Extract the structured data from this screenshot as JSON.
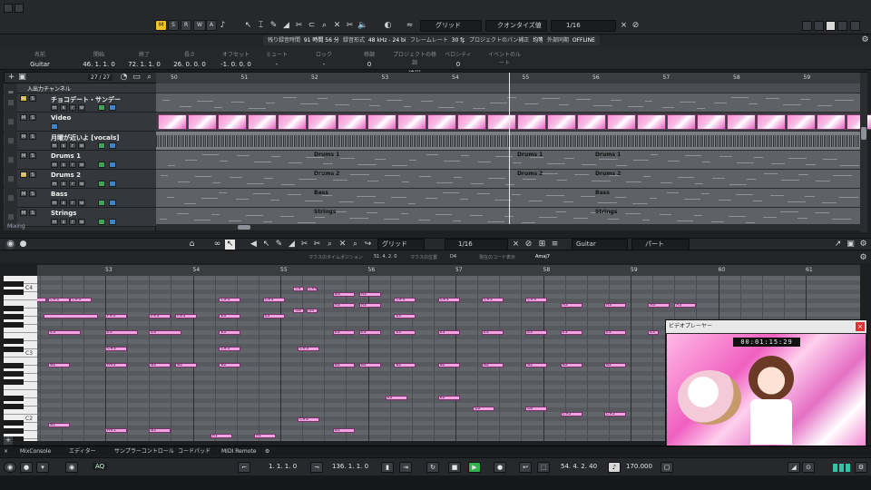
{
  "toolbar": {
    "mode_buttons": [
      "M",
      "S",
      "R",
      "W",
      "A"
    ],
    "grid_label": "グリッド",
    "quantize_label": "クオンタイズ値",
    "quantize_value": "1/16"
  },
  "status_items": [
    {
      "label": "残り録音時間",
      "value": "91 時間 56 分"
    },
    {
      "label": "録音形式",
      "value": "48 kHz - 24 bit"
    },
    {
      "label": "フレームレート",
      "value": "30 fps"
    },
    {
      "label": "プロジェクトのパン補正",
      "value": "均等パワー"
    },
    {
      "label": "外部同期",
      "value": "OFFLINE"
    }
  ],
  "info_line": {
    "name": {
      "header": "名前",
      "value": "Guitar"
    },
    "start": {
      "header": "開始",
      "value": "46. 1. 1.  0"
    },
    "end": {
      "header": "終了",
      "value": "72. 1. 1.  0"
    },
    "length": {
      "header": "長さ",
      "value": "26. 0. 0.  0"
    },
    "offset": {
      "header": "オフセット",
      "value": "-1. 0. 0.  0"
    },
    "mute": {
      "header": "ミュート",
      "value": "-"
    },
    "lock": {
      "header": "ロック",
      "value": "-"
    },
    "transpose": {
      "header": "移調",
      "value": "0"
    },
    "global": {
      "header": "プロジェクトの移調",
      "value": "追従"
    },
    "velocity": {
      "header": "ベロシティ",
      "value": "0"
    },
    "event_root": {
      "header": "イベントのルート",
      "value": "-"
    }
  },
  "project": {
    "counter": "27 / 27",
    "ruler_bars": [
      "50",
      "51",
      "52",
      "53",
      "54",
      "55",
      "56",
      "57",
      "58",
      "59"
    ],
    "tracks": [
      {
        "name": "入出力チャンネル",
        "kind": "folder"
      },
      {
        "name": "チョコデート・サンデー",
        "kind": "midi"
      },
      {
        "name": "Video",
        "kind": "video"
      },
      {
        "name": "月曜が近いよ [vocals]",
        "kind": "audio"
      },
      {
        "name": "Drums 1",
        "kind": "midi"
      },
      {
        "name": "Drums 2",
        "kind": "midi"
      },
      {
        "name": "Bass",
        "kind": "midi"
      },
      {
        "name": "Strings",
        "kind": "midi"
      }
    ],
    "mixing_label": "Mixing",
    "clip_labels": {
      "drums1": "Drums 1",
      "drums2": "Drums 2",
      "bass": "Bass",
      "strings": "Strings"
    }
  },
  "editor": {
    "grid_label": "グリッド",
    "quantize_value": "1/16",
    "track_select": "Guitar",
    "part_select": "パート",
    "info_fields": [
      {
        "label": "マウスのタイムポジション",
        "value": "51. 4. 2.  0"
      },
      {
        "label": "マウスの位置",
        "value": "D4"
      },
      {
        "label": "現在のコード表示",
        "value": "Amaj7"
      }
    ],
    "ruler_bars": [
      "53",
      "54",
      "55",
      "56",
      "57",
      "58",
      "59",
      "60",
      "61"
    ],
    "key_labels": [
      "C4",
      "C3",
      "C2"
    ]
  },
  "notes": [
    {
      "bar": 0,
      "row": 2,
      "w": 1,
      "label": ""
    },
    {
      "bar": 0.15,
      "row": 2,
      "w": 2,
      "label": "C#3"
    },
    {
      "bar": 0.4,
      "row": 2,
      "w": 2,
      "label": "C#3"
    },
    {
      "bar": 0.1,
      "row": 5,
      "w": 5,
      "label": ""
    },
    {
      "bar": 0.8,
      "row": 5,
      "w": 2,
      "label": "F#3"
    },
    {
      "bar": 1.3,
      "row": 5,
      "w": 2,
      "label": "F#3"
    },
    {
      "bar": 1.6,
      "row": 5,
      "w": 2,
      "label": "F#3"
    },
    {
      "bar": 0.15,
      "row": 8,
      "w": 3,
      "label": "E3"
    },
    {
      "bar": 0.8,
      "row": 8,
      "w": 3,
      "label": "E3"
    },
    {
      "bar": 1.3,
      "row": 8,
      "w": 3,
      "label": "E3"
    },
    {
      "bar": 0.8,
      "row": 11,
      "w": 2,
      "label": "C#3"
    },
    {
      "bar": 0.15,
      "row": 14,
      "w": 2,
      "label": "B2"
    },
    {
      "bar": 0.8,
      "row": 14,
      "w": 2,
      "label": "A#2"
    },
    {
      "bar": 1.3,
      "row": 14,
      "w": 2,
      "label": "B2"
    },
    {
      "bar": 1.6,
      "row": 14,
      "w": 2,
      "label": "B2"
    },
    {
      "bar": 0.15,
      "row": 25,
      "w": 2,
      "label": "B1"
    },
    {
      "bar": 0.8,
      "row": 26,
      "w": 2,
      "label": "A#1"
    },
    {
      "bar": 1.3,
      "row": 26,
      "w": 2,
      "label": "B1"
    },
    {
      "bar": 2.0,
      "row": 27,
      "w": 2,
      "label": "A1"
    },
    {
      "bar": 2.5,
      "row": 27,
      "w": 2,
      "label": "A1"
    },
    {
      "bar": 2.1,
      "row": 2,
      "w": 2,
      "label": "C#3"
    },
    {
      "bar": 2.6,
      "row": 2,
      "w": 2,
      "label": "C#3"
    },
    {
      "bar": 2.1,
      "row": 5,
      "w": 2,
      "label": "E3"
    },
    {
      "bar": 2.6,
      "row": 5,
      "w": 2,
      "label": "E3"
    },
    {
      "bar": 2.1,
      "row": 8,
      "w": 2,
      "label": "E3"
    },
    {
      "bar": 2.1,
      "row": 11,
      "w": 2,
      "label": "C#3"
    },
    {
      "bar": 2.1,
      "row": 14,
      "w": 2,
      "label": "B2"
    },
    {
      "bar": 2.95,
      "row": 0,
      "w": 1,
      "label": "C4"
    },
    {
      "bar": 3.1,
      "row": 0,
      "w": 1,
      "label": "C#4"
    },
    {
      "bar": 3.4,
      "row": 1,
      "w": 2,
      "label": "B3"
    },
    {
      "bar": 3.7,
      "row": 1,
      "w": 2,
      "label": "A3"
    },
    {
      "bar": 3.4,
      "row": 3,
      "w": 2,
      "label": "A3"
    },
    {
      "bar": 3.7,
      "row": 3,
      "w": 2,
      "label": "A3"
    },
    {
      "bar": 2.95,
      "row": 4,
      "w": 1,
      "label": "G3"
    },
    {
      "bar": 3.1,
      "row": 4,
      "w": 1,
      "label": "G3"
    },
    {
      "bar": 3.4,
      "row": 8,
      "w": 2,
      "label": "E3"
    },
    {
      "bar": 3.7,
      "row": 8,
      "w": 2,
      "label": "E3"
    },
    {
      "bar": 3.0,
      "row": 11,
      "w": 2,
      "label": "C#3"
    },
    {
      "bar": 3.4,
      "row": 14,
      "w": 2,
      "label": "B2"
    },
    {
      "bar": 3.7,
      "row": 14,
      "w": 2,
      "label": "B2"
    },
    {
      "bar": 3.0,
      "row": 24,
      "w": 2,
      "label": "C#2"
    },
    {
      "bar": 3.4,
      "row": 26,
      "w": 2,
      "label": "B1"
    },
    {
      "bar": 4.1,
      "row": 2,
      "w": 2,
      "label": "C#3"
    },
    {
      "bar": 4.6,
      "row": 2,
      "w": 2,
      "label": "C#3"
    },
    {
      "bar": 4.1,
      "row": 5,
      "w": 2,
      "label": "E3"
    },
    {
      "bar": 4.1,
      "row": 8,
      "w": 2,
      "label": "E3"
    },
    {
      "bar": 4.6,
      "row": 8,
      "w": 2,
      "label": "E3"
    },
    {
      "bar": 4.1,
      "row": 14,
      "w": 2,
      "label": "B2"
    },
    {
      "bar": 4.6,
      "row": 14,
      "w": 2,
      "label": "B2"
    },
    {
      "bar": 4.0,
      "row": 20,
      "w": 2,
      "label": "E2"
    },
    {
      "bar": 4.6,
      "row": 20,
      "w": 2,
      "label": "E2"
    },
    {
      "bar": 5.1,
      "row": 2,
      "w": 2,
      "label": "C#3"
    },
    {
      "bar": 5.6,
      "row": 2,
      "w": 2,
      "label": "C#3"
    },
    {
      "bar": 5.1,
      "row": 8,
      "w": 2,
      "label": "E3"
    },
    {
      "bar": 5.6,
      "row": 8,
      "w": 2,
      "label": "E3"
    },
    {
      "bar": 5.1,
      "row": 14,
      "w": 2,
      "label": "B2"
    },
    {
      "bar": 5.6,
      "row": 14,
      "w": 2,
      "label": "B2"
    },
    {
      "bar": 5.0,
      "row": 22,
      "w": 2,
      "label": "D2"
    },
    {
      "bar": 5.6,
      "row": 22,
      "w": 2,
      "label": "D2"
    },
    {
      "bar": 6.0,
      "row": 3,
      "w": 2,
      "label": "A3"
    },
    {
      "bar": 6.5,
      "row": 3,
      "w": 2,
      "label": "A3"
    },
    {
      "bar": 6.0,
      "row": 8,
      "w": 2,
      "label": "E3"
    },
    {
      "bar": 6.5,
      "row": 8,
      "w": 2,
      "label": "E3"
    },
    {
      "bar": 6.0,
      "row": 14,
      "w": 2,
      "label": "B2"
    },
    {
      "bar": 6.5,
      "row": 14,
      "w": 2,
      "label": "B2"
    },
    {
      "bar": 6.0,
      "row": 23,
      "w": 2,
      "label": "C#2"
    },
    {
      "bar": 6.5,
      "row": 23,
      "w": 2,
      "label": "C#2"
    },
    {
      "bar": 7.0,
      "row": 3,
      "w": 2,
      "label": "A3"
    },
    {
      "bar": 7.3,
      "row": 3,
      "w": 2,
      "label": "A3"
    },
    {
      "bar": 7.0,
      "row": 8,
      "w": 1,
      "label": "E3"
    }
  ],
  "video_player": {
    "title": "ビデオプレーヤー",
    "timecode": "00:01:15:29"
  },
  "tabs": [
    {
      "label": "MixConsole",
      "active": true
    },
    {
      "label": "エディター",
      "active": false
    },
    {
      "label": "サンプラーコントロール",
      "active": false
    },
    {
      "label": "コードパッド",
      "active": false
    },
    {
      "label": "MIDI Remote",
      "active": false
    }
  ],
  "transport": {
    "aq_label": "AQ",
    "left_locator": "1. 1. 1.  0",
    "right_locator": "136. 1. 1.  0",
    "position": "54. 4. 2. 40",
    "tempo": "170.000"
  }
}
